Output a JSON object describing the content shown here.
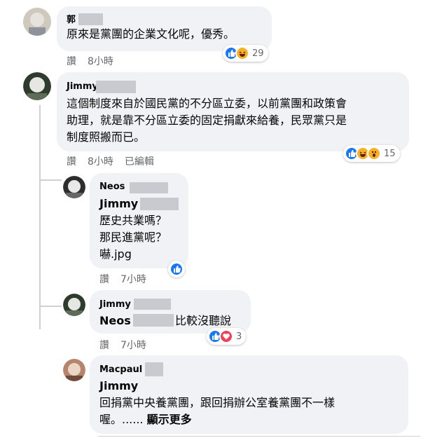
{
  "comments": [
    {
      "name": "郭",
      "lines": [
        "原來是黨團的企業文化呢，優秀。"
      ],
      "actions": {
        "like": "讚",
        "time": "8小時"
      },
      "reaction_count": "29",
      "reactions": [
        "like-icon",
        "haha-icon"
      ]
    },
    {
      "name": "Jimmy",
      "lines": [
        "這個制度來自於國民黨的不分區立委，以前黨團和政策會",
        "助理，就是靠不分區立委的固定捐獻來給養，民眾黨只是",
        "制度照搬而已。"
      ],
      "actions": {
        "like": "讚",
        "time": "8小時",
        "edited": "已編輯"
      },
      "reaction_count": "15",
      "reactions": [
        "like-icon",
        "haha-icon",
        "wow-icon"
      ]
    }
  ],
  "replies": [
    {
      "name": "Neos",
      "mention": "Jimmy",
      "lines": [
        "歷史共業嗎？",
        "那民進黨呢？",
        "嚇.jpg"
      ],
      "actions": {
        "like": "讚",
        "time": "7小時"
      },
      "reactions": [
        "like-icon"
      ]
    },
    {
      "name": "Jimmy",
      "mention": "Neos",
      "text_after_mention": "比較沒聽說",
      "actions": {
        "like": "讚",
        "time": "7小時"
      },
      "reaction_count": "3",
      "reactions": [
        "like-icon",
        "love-icon"
      ]
    },
    {
      "name": "Macpaul",
      "mention": "Jimmy",
      "lines": [
        "回捐黨中央養黨團，跟回捐辦公室養黨團不一樣",
        "喔。......"
      ],
      "see_more": "顯示更多"
    }
  ]
}
